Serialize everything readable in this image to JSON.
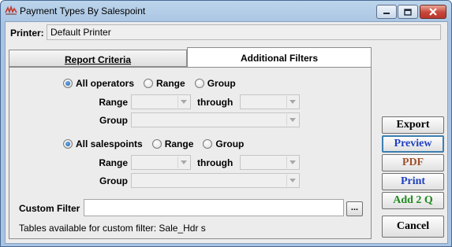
{
  "window": {
    "title": "Payment Types By Salespoint"
  },
  "printer": {
    "label": "Printer:",
    "value": "Default Printer"
  },
  "tabs": [
    {
      "label": "Report Criteria",
      "active": false
    },
    {
      "label": "Additional Filters",
      "active": true
    }
  ],
  "operators": {
    "options": [
      "All operators",
      "Range",
      "Group"
    ],
    "selected": "All operators",
    "range_label": "Range",
    "through_label": "through",
    "group_label": "Group"
  },
  "salespoints": {
    "options": [
      "All salespoints",
      "Range",
      "Group"
    ],
    "selected": "All salespoints",
    "range_label": "Range",
    "through_label": "through",
    "group_label": "Group"
  },
  "custom_filter": {
    "label": "Custom Filter",
    "value": "",
    "browse_label": "...",
    "tables_note": "Tables available for custom filter: Sale_Hdr s"
  },
  "actions": [
    {
      "label": "Export",
      "color": "#000000"
    },
    {
      "label": "Preview",
      "color": "#1f3fbf"
    },
    {
      "label": "PDF",
      "color": "#a0502a"
    },
    {
      "label": "Print",
      "color": "#1f3fbf"
    },
    {
      "label": "Add 2 Q",
      "color": "#1e8a1e"
    },
    {
      "label": "Cancel",
      "color": "#000000"
    }
  ]
}
